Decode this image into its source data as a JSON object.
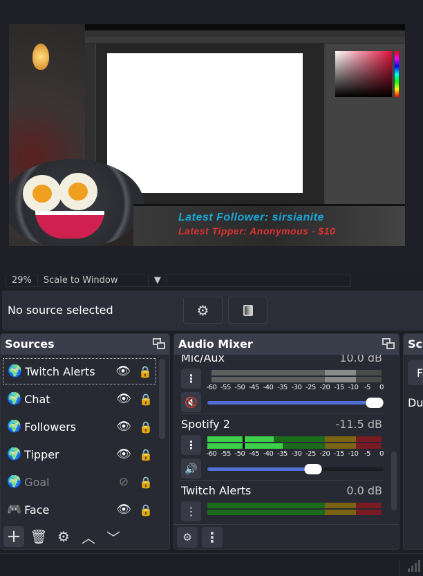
{
  "preview": {
    "banner_follower": "Latest Follower: sirsianite",
    "banner_tipper": "Latest Tipper: Anonymous - $10"
  },
  "statusbar": {
    "zoom": "29%",
    "scale_mode": "Scale to Window"
  },
  "source_toolbar": {
    "label": "No source selected",
    "properties_icon": "gear-icon",
    "filters_icon": "filter-icon"
  },
  "sources": {
    "title": "Sources",
    "items": [
      {
        "label": "Twitch Alerts",
        "icon": "globe-icon",
        "visible": true,
        "locked": true,
        "selected": true
      },
      {
        "label": "Chat",
        "icon": "globe-icon",
        "visible": true,
        "locked": true
      },
      {
        "label": "Followers",
        "icon": "globe-icon",
        "visible": true,
        "locked": true
      },
      {
        "label": "Tipper",
        "icon": "globe-icon",
        "visible": true,
        "locked": true
      },
      {
        "label": "Goal",
        "icon": "globe-icon",
        "visible": false,
        "locked": true
      },
      {
        "label": "Face",
        "icon": "gamepad-icon",
        "visible": true,
        "locked": true
      }
    ]
  },
  "audio_mixer": {
    "title": "Audio Mixer",
    "ticks": [
      "-60",
      "-55",
      "-50",
      "-45",
      "-40",
      "-35",
      "-30",
      "-25",
      "-20",
      "-15",
      "-10",
      "-5",
      "0"
    ],
    "channels": [
      {
        "name": "Mic/Aux",
        "db": "10.0 dB",
        "muted": true,
        "volume": 1.0
      },
      {
        "name": "Spotify 2",
        "db": "-11.5 dB",
        "muted": false,
        "volume": 0.6,
        "level_db": [
          -38,
          -35
        ]
      },
      {
        "name": "Twitch Alerts",
        "db": "0.0 dB",
        "muted": false
      }
    ]
  },
  "transitions": {
    "title": "Sc",
    "select": "Fa",
    "duration_label": "Dur"
  },
  "colors": {
    "meter_green": "#2c9c2c",
    "meter_yellow": "#7a6414",
    "meter_red": "#7a1a22",
    "accent": "#4f6fd6"
  }
}
